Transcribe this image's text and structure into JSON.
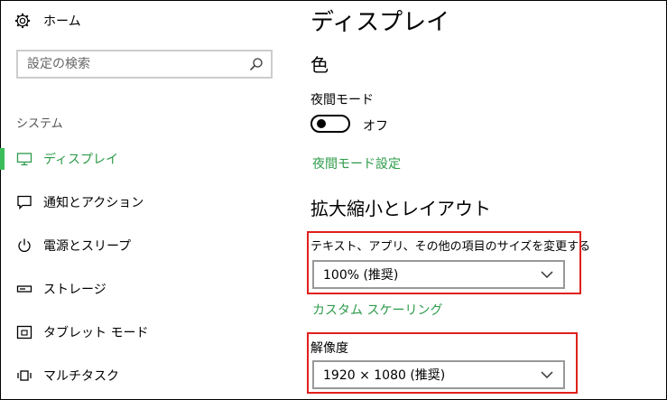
{
  "sidebar": {
    "home_label": "ホーム",
    "search_placeholder": "設定の検索",
    "section_title": "システム",
    "items": [
      {
        "label": "ディスプレイ",
        "icon": "monitor-icon",
        "active": true
      },
      {
        "label": "通知とアクション",
        "icon": "notification-icon",
        "active": false
      },
      {
        "label": "電源とスリープ",
        "icon": "power-icon",
        "active": false
      },
      {
        "label": "ストレージ",
        "icon": "storage-icon",
        "active": false
      },
      {
        "label": "タブレット モード",
        "icon": "tablet-mode-icon",
        "active": false
      },
      {
        "label": "マルチタスク",
        "icon": "multitask-icon",
        "active": false
      }
    ]
  },
  "main": {
    "title": "ディスプレイ",
    "color_heading": "色",
    "night_mode_label": "夜間モード",
    "night_mode_toggle_state": "オフ",
    "night_mode_settings_link": "夜間モード設定",
    "scale_layout_heading": "拡大縮小とレイアウト",
    "text_size_label": "テキスト、アプリ、その他の項目のサイズを変更する",
    "scale_value": "100% (推奨)",
    "custom_scaling_link": "カスタム スケーリング",
    "resolution_label": "解像度",
    "resolution_value": "1920 × 1080 (推奨)"
  },
  "colors": {
    "accent": "#2d9b4a",
    "active_indicator": "#3bbd5a",
    "highlight_border": "#e0201c"
  }
}
